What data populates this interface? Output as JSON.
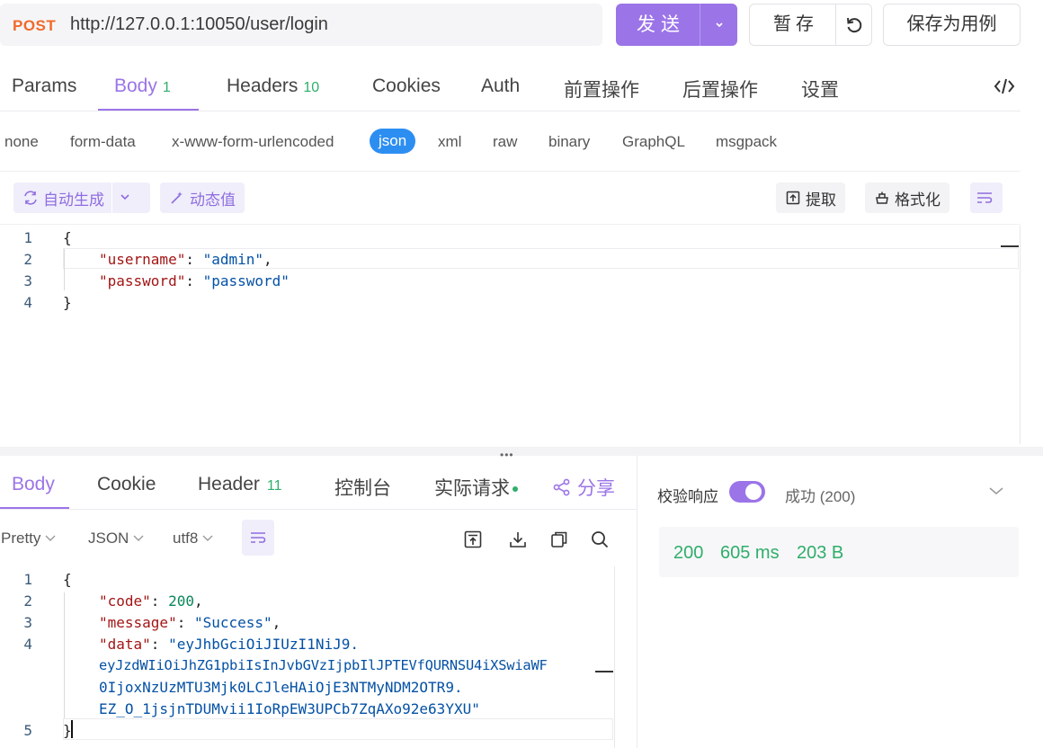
{
  "request": {
    "method": "POST",
    "url": "http://127.0.0.1:10050/user/login",
    "send_label": "发送",
    "save_draft_label": "暂存",
    "save_case_label": "保存为用例"
  },
  "tabs": [
    {
      "label": "Params"
    },
    {
      "label": "Body",
      "count": "1"
    },
    {
      "label": "Headers",
      "count": "10"
    },
    {
      "label": "Cookies"
    },
    {
      "label": "Auth"
    },
    {
      "label": "前置操作"
    },
    {
      "label": "后置操作"
    },
    {
      "label": "设置"
    }
  ],
  "body_types": [
    "none",
    "form-data",
    "x-www-form-urlencoded",
    "json",
    "xml",
    "raw",
    "binary",
    "GraphQL",
    "msgpack"
  ],
  "editor_toolbar": {
    "auto_generate": "自动生成",
    "dynamic_value": "动态值",
    "extract": "提取",
    "format": "格式化"
  },
  "request_body": {
    "line_numbers": [
      "1",
      "2",
      "3",
      "4"
    ],
    "open_brace": "{",
    "close_brace": "}",
    "username_key": "\"username\"",
    "username_value": "\"admin\"",
    "password_key": "\"password\"",
    "password_value": "\"password\""
  },
  "response": {
    "tabs": [
      {
        "label": "Body"
      },
      {
        "label": "Cookie"
      },
      {
        "label": "Header",
        "count": "11"
      },
      {
        "label": "控制台"
      },
      {
        "label": "实际请求"
      }
    ],
    "share_label": "分享",
    "view_mode": "Pretty",
    "format": "JSON",
    "encoding": "utf8",
    "line_numbers": [
      "1",
      "2",
      "3",
      "4",
      "5"
    ],
    "open_brace": "{",
    "close_brace": "}",
    "code_key": "\"code\"",
    "code_value": "200",
    "message_key": "\"message\"",
    "message_value": "\"Success\"",
    "data_key": "\"data\"",
    "data_line1": "\"eyJhbGciOiJIUzI1NiJ9.",
    "data_line2": "eyJzdWIiOiJhZG1pbiIsInJvbGVzIjpbIlJPTEVfQURNSU4iXSwiaWF",
    "data_line3": "0IjoxNzUzMTU3Mjk0LCJleHAiOjE3NTMyNDM2OTR9.",
    "data_line4": "EZ_O_1jsjnTDUMvii1IoRpEW3UPCb7ZqAXo92e63YXU\""
  },
  "verify": {
    "label": "校验响应",
    "enabled": true,
    "status": "成功 (200)",
    "code": "200",
    "time": "605 ms",
    "size": "203 B"
  },
  "colors": {
    "accent": "#9b74e8",
    "method": "#f06a2a",
    "success": "#2fae6a",
    "json_active": "#2d8ef2"
  }
}
